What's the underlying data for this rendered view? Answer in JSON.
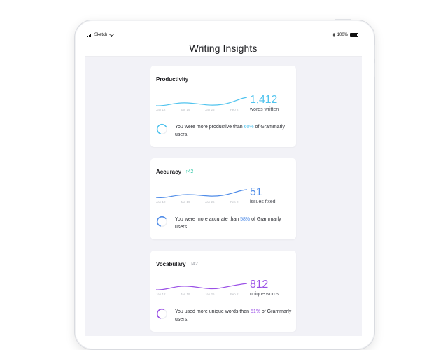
{
  "status_bar": {
    "carrier": "Sketch",
    "battery": "100%"
  },
  "page_title": "Writing Insights",
  "colors": {
    "productivity": "#4fc3ee",
    "accuracy": "#4f8ce8",
    "vocabulary": "#9a50e6",
    "up": "#2dc7a5",
    "neutral": "#a3a6ad"
  },
  "cards": {
    "productivity": {
      "title": "Productivity",
      "value": "1,412",
      "label": "words written",
      "dates": [
        "Jan 12",
        "Jan 19",
        "Jan 26",
        "Feb 2"
      ],
      "message_pre": "You were more productive than ",
      "percent": "60%",
      "message_post": " of Grammarly users.",
      "ring_fraction": 0.6
    },
    "accuracy": {
      "title": "Accuracy",
      "trend": "↑42",
      "value": "51",
      "label": "issues fixed",
      "dates": [
        "Jan 12",
        "Jan 19",
        "Jan 26",
        "Feb 2"
      ],
      "message_pre": "You were more accurate than ",
      "percent": "58%",
      "message_post": " of Grammarly users.",
      "ring_fraction": 0.58
    },
    "vocabulary": {
      "title": "Vocabulary",
      "trend": "↓42",
      "value": "812",
      "label": "unique words",
      "dates": [
        "Jan 12",
        "Jan 19",
        "Jan 26",
        "Feb 2"
      ],
      "message_pre": "You used more unique words than ",
      "percent": "51%",
      "message_post": " of Grammarly users.",
      "ring_fraction": 0.51
    }
  }
}
